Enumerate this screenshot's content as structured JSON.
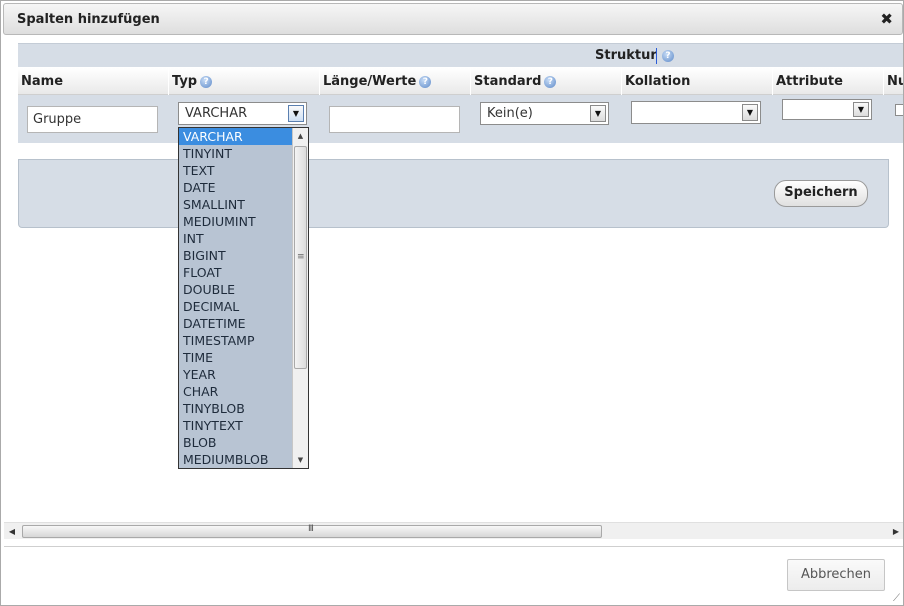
{
  "dialog": {
    "title": "Spalten hinzufügen",
    "close_icon": "✖"
  },
  "structure": {
    "label": "Struktur"
  },
  "columns": {
    "name": "Name",
    "type": "Typ",
    "length": "Länge/Werte",
    "default": "Standard",
    "collation": "Kollation",
    "attributes": "Attribute",
    "null": "Nu"
  },
  "row": {
    "name_value": "Gruppe",
    "type_value": "VARCHAR",
    "length_value": "",
    "default_value": "Kein(e)",
    "collation_value": "",
    "attributes_value": ""
  },
  "type_dropdown": {
    "options": [
      "VARCHAR",
      "TINYINT",
      "TEXT",
      "DATE",
      "SMALLINT",
      "MEDIUMINT",
      "INT",
      "BIGINT",
      "FLOAT",
      "DOUBLE",
      "DECIMAL",
      "DATETIME",
      "TIMESTAMP",
      "TIME",
      "YEAR",
      "CHAR",
      "TINYBLOB",
      "TINYTEXT",
      "BLOB",
      "MEDIUMBLOB"
    ],
    "selected": "VARCHAR"
  },
  "buttons": {
    "save": "Speichern",
    "cancel": "Abbrechen"
  },
  "icons": {
    "help": "?",
    "dropdown_arrow": "▼",
    "scroll_up": "▲",
    "scroll_down": "▼",
    "scroll_left": "◀",
    "scroll_right": "▶",
    "grip_v": "≡",
    "grip_h": "III",
    "resize": "⟋"
  },
  "colors": {
    "accent": "#3b8de0",
    "band": "#d6dde6",
    "list_bg": "#b8c4d3"
  }
}
